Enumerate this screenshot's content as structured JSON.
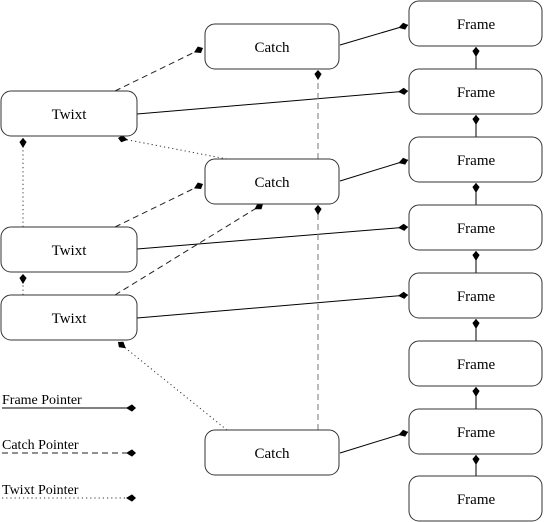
{
  "diagram": {
    "nodes": {
      "frames": [
        "Frame",
        "Frame",
        "Frame",
        "Frame",
        "Frame",
        "Frame",
        "Frame",
        "Frame"
      ],
      "catches": [
        "Catch",
        "Catch",
        "Catch"
      ],
      "twixts": [
        "Twixt",
        "Twixt",
        "Twixt"
      ]
    },
    "edges": [
      {
        "from": "frame-2",
        "to": "frame-1",
        "kind": "frame"
      },
      {
        "from": "frame-3",
        "to": "frame-2",
        "kind": "frame"
      },
      {
        "from": "frame-4",
        "to": "frame-3",
        "kind": "frame"
      },
      {
        "from": "frame-5",
        "to": "frame-4",
        "kind": "frame"
      },
      {
        "from": "frame-6",
        "to": "frame-5",
        "kind": "frame"
      },
      {
        "from": "frame-7",
        "to": "frame-6",
        "kind": "frame"
      },
      {
        "from": "frame-8",
        "to": "frame-7",
        "kind": "frame"
      },
      {
        "from": "catch-1",
        "to": "frame-1",
        "kind": "frame"
      },
      {
        "from": "catch-2",
        "to": "frame-3",
        "kind": "frame"
      },
      {
        "from": "catch-3",
        "to": "frame-7",
        "kind": "frame"
      },
      {
        "from": "twixt-1",
        "to": "frame-2",
        "kind": "frame"
      },
      {
        "from": "twixt-2",
        "to": "frame-4",
        "kind": "frame"
      },
      {
        "from": "twixt-3",
        "to": "frame-5",
        "kind": "frame"
      },
      {
        "from": "twixt-1",
        "to": "catch-1",
        "kind": "catch"
      },
      {
        "from": "twixt-2",
        "to": "catch-2",
        "kind": "catch"
      },
      {
        "from": "twixt-3",
        "to": "catch-2",
        "kind": "catch"
      },
      {
        "from": "catch-2",
        "to": "catch-1",
        "kind": "catch"
      },
      {
        "from": "catch-3",
        "to": "catch-2",
        "kind": "catch"
      },
      {
        "from": "catch-2",
        "to": "twixt-1",
        "kind": "twixt"
      },
      {
        "from": "twixt-2",
        "to": "twixt-1",
        "kind": "twixt"
      },
      {
        "from": "twixt-3",
        "to": "twixt-2",
        "kind": "twixt"
      },
      {
        "from": "catch-3",
        "to": "twixt-3",
        "kind": "twixt"
      }
    ]
  },
  "legend": {
    "frame_pointer": "Frame Pointer",
    "catch_pointer": "Catch Pointer",
    "twixt_pointer": "Twixt Pointer"
  }
}
